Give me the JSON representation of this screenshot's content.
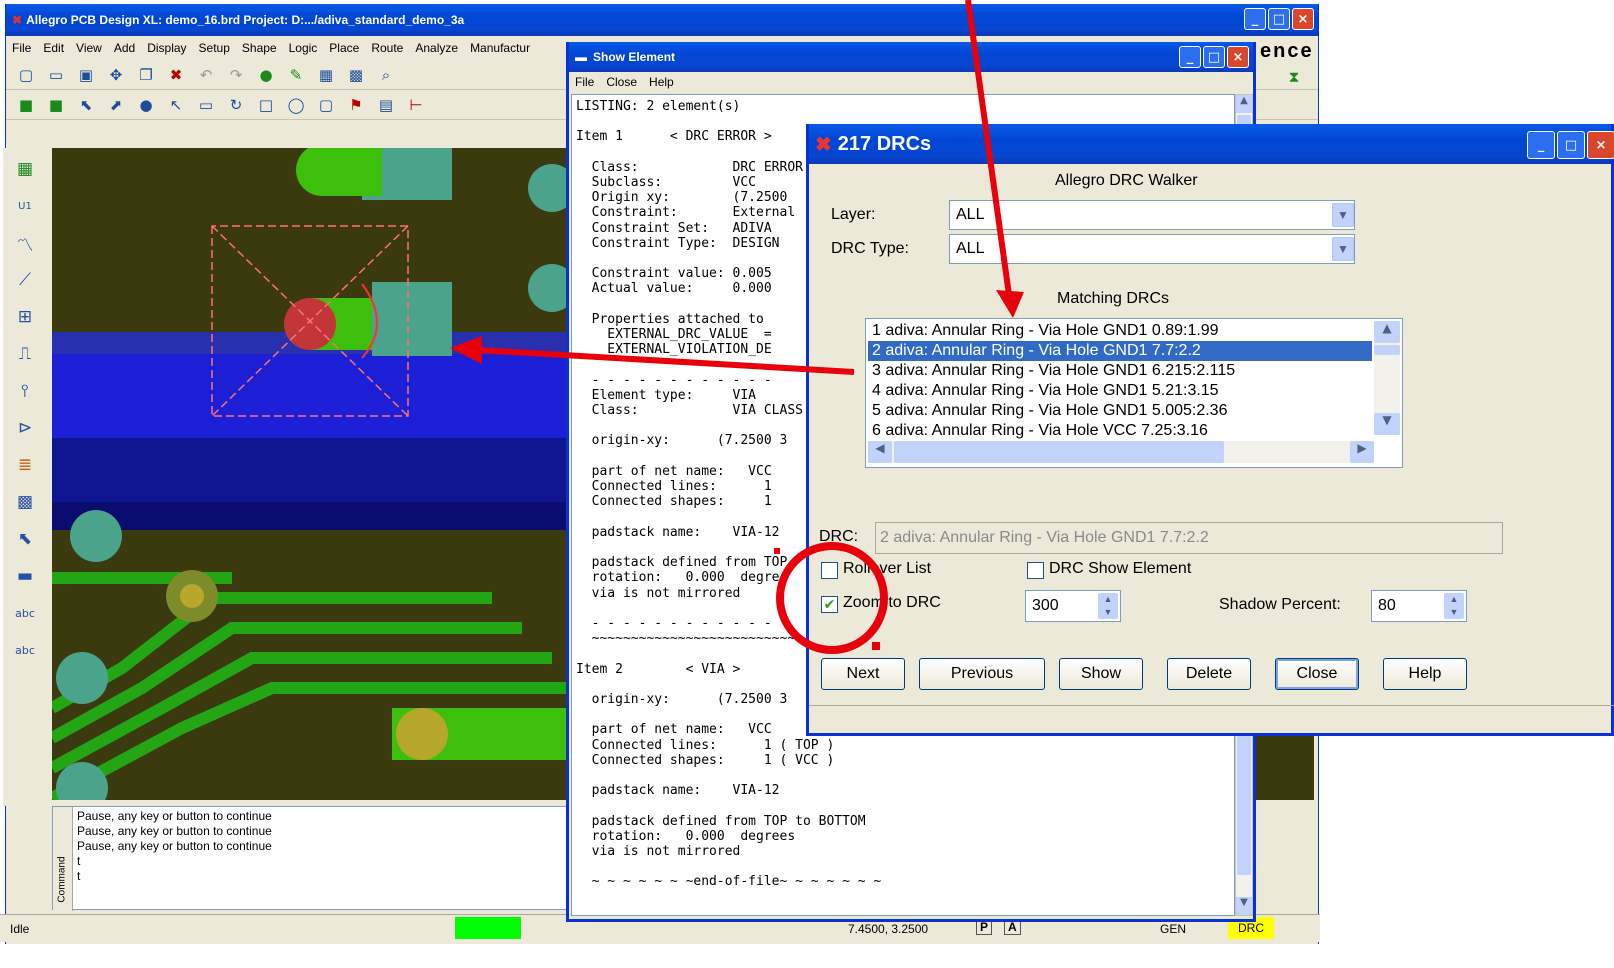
{
  "main_window": {
    "title": "Allegro PCB Design XL: demo_16.brd  Project: D:.../adiva_standard_demo_3a",
    "menu": [
      "File",
      "Edit",
      "View",
      "Add",
      "Display",
      "Setup",
      "Shape",
      "Logic",
      "Place",
      "Route",
      "Analyze",
      "Manufactur"
    ],
    "brand_fragment": "ence",
    "console_lines": [
      "Pause, any key or button to continue",
      "Pause, any key or button to continue",
      "Pause, any key or button to continue",
      "t",
      "t"
    ],
    "console_tab": "Command",
    "status": {
      "state": "Idle",
      "coords": "7.4500, 3.2500",
      "p_label": "P",
      "a_label": "A",
      "gen": "GEN",
      "drc": "DRC"
    }
  },
  "show_element": {
    "title": "Show Element",
    "menu": [
      "File",
      "Close",
      "Help"
    ],
    "listing": "LISTING: 2 element(s)\n\nItem 1      < DRC ERROR >\n\n  Class:            DRC ERROR\n  Subclass:         VCC\n  Origin xy:        (7.2500\n  Constraint:       External\n  Constraint Set:   ADIVA\n  Constraint Type:  DESIGN\n\n  Constraint value: 0.005\n  Actual value:     0.000\n\n  Properties attached to\n    EXTERNAL_DRC_VALUE  =\n    EXTERNAL_VIOLATION_DE\n\n  - - - - - - - - - - - -\n  Element type:     VIA\n  Class:            VIA CLASS\n\n  origin-xy:      (7.2500 3\n\n  part of net name:   VCC\n  Connected lines:      1\n  Connected shapes:     1\n\n  padstack name:    VIA-12\n\n  padstack defined from TOP\n  rotation:   0.000  degre\n  via is not mirrored\n\n  - - - - - - - - - - - -\n  ~~~~~~~~~~~~~~~~~~~~~~~~~~~\n\nItem 2        < VIA >\n\n  origin-xy:      (7.2500 3\n\n  part of net name:   VCC\n  Connected lines:      1 ( TOP )\n  Connected shapes:     1 ( VCC )\n\n  padstack name:    VIA-12\n\n  padstack defined from TOP to BOTTOM\n  rotation:   0.000  degrees\n  via is not mirrored\n\n  ~ ~ ~ ~ ~ ~ ~end-of-file~ ~ ~ ~ ~ ~ ~"
  },
  "drc_window": {
    "title": "217 DRCs",
    "heading": "Allegro DRC Walker",
    "layer_label": "Layer:",
    "layer_value": "ALL",
    "drc_type_label": "DRC Type:",
    "drc_type_value": "ALL",
    "matching_label": "Matching DRCs",
    "items": [
      "1 adiva:  Annular Ring - Via Hole GND1 0.89:1.99",
      "2 adiva:  Annular Ring - Via Hole GND1 7.7:2.2",
      "3 adiva:  Annular Ring - Via Hole GND1 6.215:2.115",
      "4 adiva:  Annular Ring - Via Hole GND1 5.21:3.15",
      "5 adiva:  Annular Ring - Via Hole GND1 5.005:2.36",
      "6 adiva:  Annular Ring - Via Hole VCC 7.25:3.16"
    ],
    "selected_index": 1,
    "drc_label": "DRC:",
    "drc_value": "2 adiva:  Annular Ring - Via Hole GND1 7.7:2.2",
    "rollover_label": "Rollover List",
    "rollover_checked": false,
    "show_element_label": "DRC Show Element",
    "show_element_checked": false,
    "zoom_label": "Zoom to DRC",
    "zoom_checked": true,
    "zoom_value": "300",
    "shadow_label": "Shadow Percent:",
    "shadow_value": "80",
    "buttons": {
      "next": "Next",
      "previous": "Previous",
      "show": "Show",
      "delete": "Delete",
      "close": "Close",
      "help": "Help"
    }
  },
  "colors": {
    "annotation": "#e8000b",
    "selection": "#316ac5",
    "titlebar": "#0046d5"
  }
}
